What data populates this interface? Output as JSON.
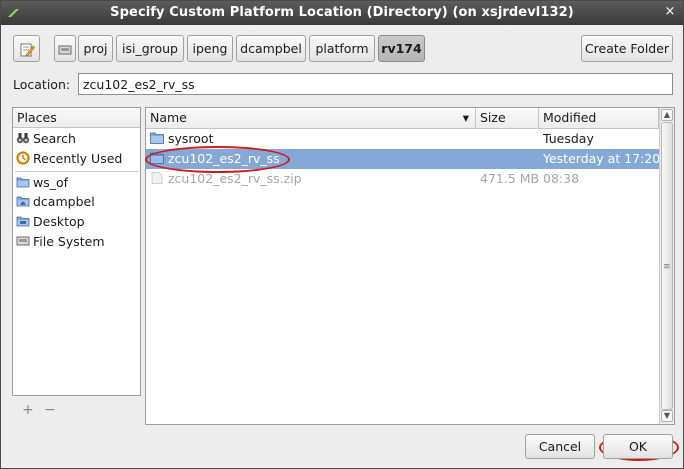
{
  "window": {
    "title": "Specify Custom Platform Location (Directory) (on xsjrdevl132)",
    "close_glyph": "×"
  },
  "pathbar": {
    "toggle_icon": "edit-location-icon",
    "drive_icon": "drive-icon",
    "segments": [
      "proj",
      "isi_group",
      "ipeng",
      "dcampbel",
      "platform",
      "rv174"
    ],
    "active_segment": "rv174"
  },
  "create_folder_label": "Create Folder",
  "location": {
    "label": "Location:",
    "value": "zcu102_es2_rv_ss"
  },
  "places": {
    "header": "Places",
    "system": [
      {
        "label": "Search",
        "icon": "binoculars-icon"
      },
      {
        "label": "Recently Used",
        "icon": "clock-icon"
      }
    ],
    "bookmarks": [
      {
        "label": "ws_of",
        "icon": "folder-icon"
      },
      {
        "label": "dcampbel",
        "icon": "home-folder-icon"
      },
      {
        "label": "Desktop",
        "icon": "desktop-folder-icon"
      },
      {
        "label": "File System",
        "icon": "drive-icon"
      }
    ],
    "add_glyph": "+",
    "remove_glyph": "−"
  },
  "files": {
    "columns": {
      "name": "Name",
      "size": "Size",
      "modified": "Modified"
    },
    "sort_glyph": "▾",
    "rows": [
      {
        "name": "sysroot",
        "size": "",
        "modified": "Tuesday",
        "state": "normal",
        "icon": "folder-icon"
      },
      {
        "name": "zcu102_es2_rv_ss",
        "size": "",
        "modified": "Yesterday at 17:20",
        "state": "selected",
        "icon": "folder-icon"
      },
      {
        "name": "zcu102_es2_rv_ss.zip",
        "size": "471.5 MB",
        "modified": "08:38",
        "state": "dim",
        "icon": "file-icon"
      }
    ]
  },
  "buttons": {
    "cancel": "Cancel",
    "ok": "OK"
  },
  "colors": {
    "selection": "#86a8d6",
    "annotation": "#d11a1a",
    "titlebar": "#3a3a3a"
  }
}
